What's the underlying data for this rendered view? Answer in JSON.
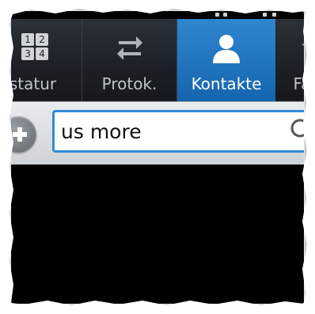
{
  "tabs": [
    {
      "label": "statur",
      "icon": "keypad-icon",
      "keys": [
        "1",
        "2",
        "3",
        "4"
      ]
    },
    {
      "label": "Protok.",
      "icon": "swap-arrows-icon"
    },
    {
      "label": "Kontakte",
      "icon": "person-icon",
      "active": true
    },
    {
      "label": "Favo",
      "icon": "star-icon"
    }
  ],
  "search": {
    "value": "us more",
    "icon": "search-icon"
  },
  "add_button": {
    "icon": "plus-icon"
  },
  "colors": {
    "active_tab": "#1e73bf",
    "search_border": "#2f8ad8",
    "tabbar_bg": "#1c2026"
  }
}
